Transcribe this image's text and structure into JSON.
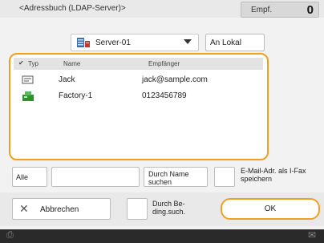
{
  "header": {
    "title": "<Adressbuch (LDAP-Server)>",
    "recipients_label": "Empf.",
    "recipients_count": "0"
  },
  "server": {
    "selected": "Server-01",
    "local_button": "An Lokal"
  },
  "list": {
    "columns": {
      "check": "✔",
      "type": "Typ",
      "name": "Name",
      "recipient": "Empfänger"
    },
    "rows": [
      {
        "type_icon": "email-icon",
        "name": "Jack",
        "recipient": "jack@sample.com"
      },
      {
        "type_icon": "fax-icon",
        "name": "Factory-1",
        "recipient": "0123456789"
      }
    ]
  },
  "controls": {
    "all_button": "Alle",
    "search_value": "",
    "name_search_button": "Durch Name suchen",
    "save_email_as_ifax_label": "E-Mail-Adr. als I-Fax speichern"
  },
  "footer": {
    "cancel_button": "Abbrechen",
    "condition_search_label": "Durch Be- ding.such.",
    "ok_button": "OK"
  },
  "colors": {
    "accent": "#f0a020",
    "header_bg": "#e9e9e9",
    "status_bar": "#2a2a2a"
  }
}
